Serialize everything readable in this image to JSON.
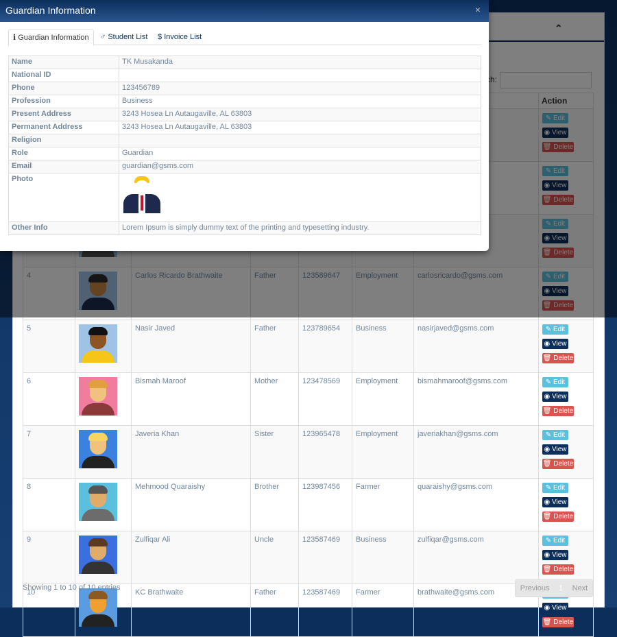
{
  "modal": {
    "title": "Guardian Information",
    "close": "×",
    "tabs": [
      {
        "label": "Guardian Information"
      },
      {
        "label": "Student List"
      },
      {
        "label": "Invoice List"
      }
    ],
    "fields": [
      {
        "label": "Name",
        "value": "TK Musakanda"
      },
      {
        "label": "National ID",
        "value": ""
      },
      {
        "label": "Phone",
        "value": "123456789"
      },
      {
        "label": "Profession",
        "value": "Business"
      },
      {
        "label": "Present Address",
        "value": "3243 Hosea Ln Autaugaville, AL 63803"
      },
      {
        "label": "Permanent Address",
        "value": "3243 Hosea Ln Autaugaville, AL 63803"
      },
      {
        "label": "Religion",
        "value": ""
      },
      {
        "label": "Role",
        "value": "Guardian"
      },
      {
        "label": "Email",
        "value": "guardian@gsms.com"
      },
      {
        "label": "Photo",
        "value": ""
      },
      {
        "label": "Other Info",
        "value": "Lorem Ipsum is simply dummy text of the printing and typesetting industry."
      }
    ]
  },
  "list": {
    "search_label": "ch:",
    "action_header": "Action",
    "buttons": {
      "edit": "Edit",
      "view": "View",
      "delete": "Delete"
    },
    "rows": [
      {
        "sl": "",
        "name": "",
        "relation": "",
        "phone": "",
        "profession": "",
        "email": "",
        "colors": {
          "skin": "#e0ac69",
          "hair": "#333",
          "shirt": "#333"
        }
      },
      {
        "sl": "",
        "name": "",
        "relation": "",
        "phone": "",
        "profession": "",
        "email": "om",
        "colors": {
          "skin": "#e0ac69",
          "hair": "#333",
          "shirt": "#555"
        }
      },
      {
        "sl": "",
        "name": "",
        "relation": "",
        "phone": "",
        "profession": "",
        "email": "om",
        "colors": {
          "skin": "#e0ac69",
          "hair": "#333",
          "shirt": "#555"
        }
      },
      {
        "sl": "4",
        "name": "Carlos Ricardo Brathwaite",
        "relation": "Father",
        "phone": "123589647",
        "profession": "Employment",
        "email": "carlosricardo@gsms.com",
        "colors": {
          "skin": "#c68642",
          "hair": "#2b2b2b",
          "shirt": "#1d2a4d"
        }
      },
      {
        "sl": "5",
        "name": "Nasir Javed",
        "relation": "Father",
        "phone": "123789654",
        "profession": "Business",
        "email": "nasirjaved@gsms.com",
        "colors": {
          "skin": "#8d5524",
          "hair": "#111",
          "shirt": "#f5c518"
        }
      },
      {
        "sl": "6",
        "name": "Bismah Maroof",
        "relation": "Mother",
        "phone": "123478569",
        "profession": "Employment",
        "email": "bismahmaroof@gsms.com",
        "colors": {
          "skin": "#f1c27d",
          "hair": "#e0a040",
          "shirt": "#8b3a3a",
          "bg": "#f07ca0"
        }
      },
      {
        "sl": "7",
        "name": "Javeria Khan",
        "relation": "Sister",
        "phone": "123965478",
        "profession": "Employment",
        "email": "javeriakhan@gsms.com",
        "colors": {
          "skin": "#f1c27d",
          "hair": "#f7d560",
          "shirt": "#222",
          "bg": "#3b82e0"
        }
      },
      {
        "sl": "8",
        "name": "Mehmood Quaraishy",
        "relation": "Brother",
        "phone": "123987456",
        "profession": "Farmer",
        "email": "quaraishy@gsms.com",
        "colors": {
          "skin": "#e0ac69",
          "hair": "#555",
          "shirt": "#6c6c6c",
          "bg": "#5bc0de"
        }
      },
      {
        "sl": "9",
        "name": "Zulfiqar Ali",
        "relation": "Uncle",
        "phone": "123587469",
        "profession": "Business",
        "email": "zulfiqar@gsms.com",
        "colors": {
          "skin": "#e0ac69",
          "hair": "#5a3b22",
          "shirt": "#333",
          "bg": "#3b6fe0"
        }
      },
      {
        "sl": "10",
        "name": "KC Brathwaite",
        "relation": "Father",
        "phone": "123587469",
        "profession": "Farmer",
        "email": "brathwaite@gsms.com",
        "colors": {
          "skin": "#f0a030",
          "hair": "#8a5a20",
          "shirt": "#222",
          "bg": "#5b9be0"
        }
      }
    ],
    "footer_info": "Showing 1 to 10 of 10 entries",
    "pager": {
      "previous": "Previous",
      "current": "1",
      "next": "Next"
    }
  }
}
